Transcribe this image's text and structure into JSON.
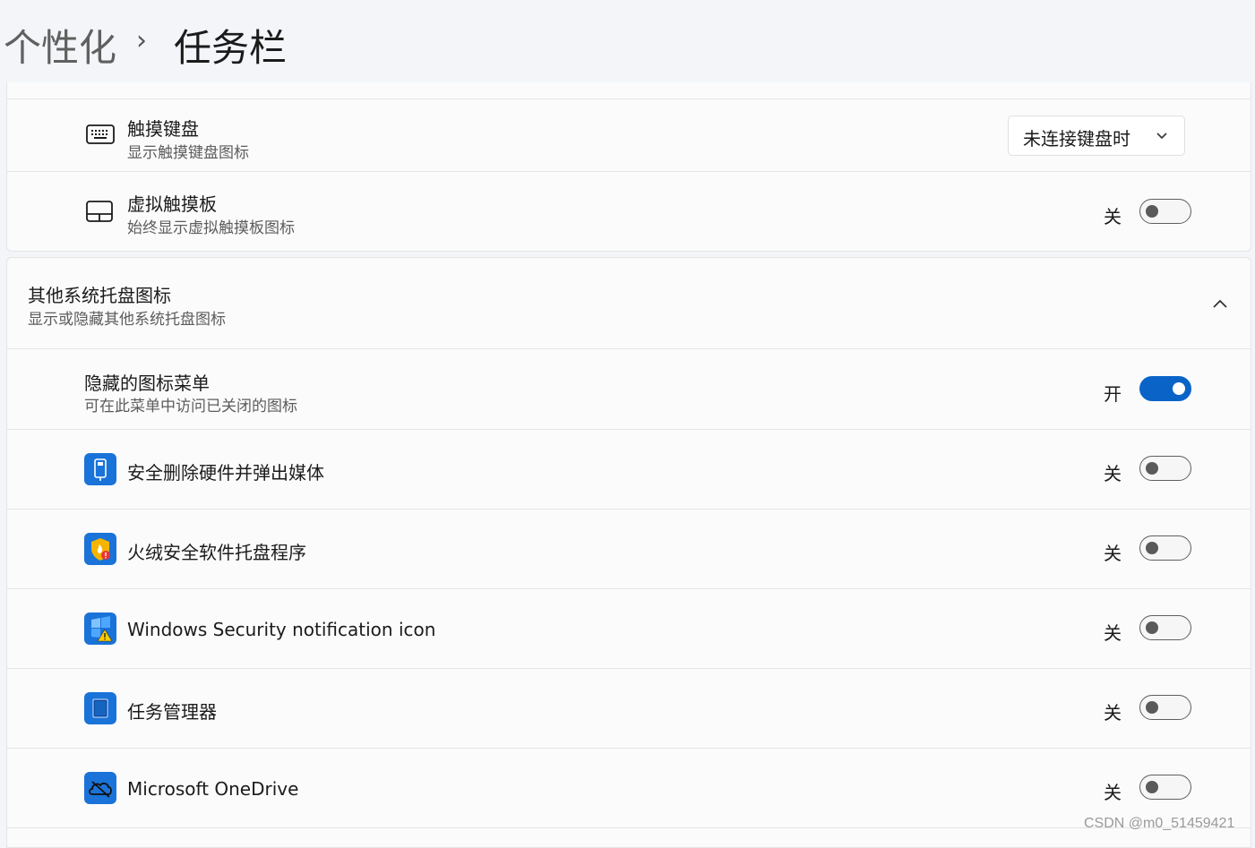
{
  "breadcrumb": {
    "parent": "个性化",
    "separator": "›",
    "current": "任务栏"
  },
  "touch_keyboard": {
    "icon": "keyboard-icon",
    "title": "触摸键盘",
    "subtitle": "显示触摸键盘图标",
    "dropdown_value": "未连接键盘时"
  },
  "virtual_touchpad": {
    "icon": "touchpad-icon",
    "title": "虚拟触摸板",
    "subtitle": "始终显示虚拟触摸板图标",
    "state": "关"
  },
  "other_tray": {
    "title": "其他系统托盘图标",
    "subtitle": "显示或隐藏其他系统托盘图标",
    "expander_icon": "chevron-up-icon"
  },
  "hidden_menu": {
    "title": "隐藏的图标菜单",
    "subtitle": "可在此菜单中访问已关闭的图标",
    "state": "开"
  },
  "apps": [
    {
      "name": "安全删除硬件并弹出媒体",
      "icon": "usb-eject-icon",
      "state": "关"
    },
    {
      "name": "火绒安全软件托盘程序",
      "icon": "huorong-shield-icon",
      "state": "关"
    },
    {
      "name": "Windows Security notification icon",
      "icon": "windows-security-icon",
      "state": "关"
    },
    {
      "name": "任务管理器",
      "icon": "task-manager-icon",
      "state": "关"
    },
    {
      "name": "Microsoft OneDrive",
      "icon": "onedrive-icon",
      "state": "关"
    }
  ],
  "watermark": "CSDN @m0_51459421",
  "colors": {
    "accent": "#0a64c8",
    "icon_blue": "#1a73d8",
    "page_bg": "#f3f5f9",
    "card_bg": "#fbfbfc"
  }
}
